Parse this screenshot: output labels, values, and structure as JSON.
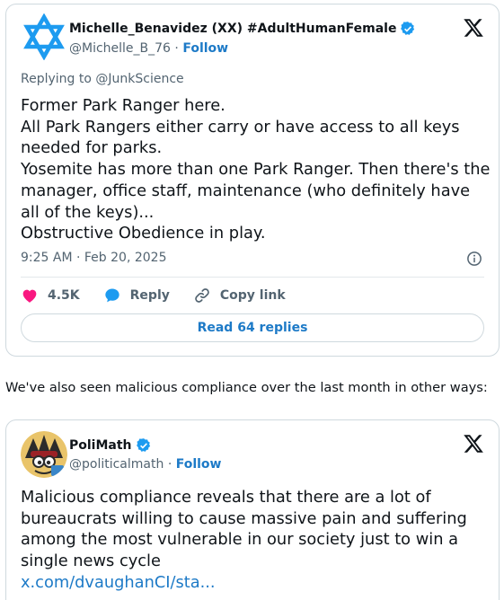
{
  "tweet1": {
    "author_name": "Michelle_Benavidez (XX) #AdultHumanFemale",
    "handle": "@Michelle_B_76",
    "separator": "·",
    "follow_label": "Follow",
    "avatar_icon": "star-of-david-icon",
    "reply_to": "Replying to @JunkScience",
    "text_lines": [
      "Former Park Ranger here.",
      "All Park Rangers either carry or have access to all keys",
      "needed for parks.",
      "Yosemite has more than one Park Ranger. Then there's the",
      "manager, office staff,  maintenance (who definitely have",
      "all of the keys)...",
      "Obstructive Obedience in play."
    ],
    "timestamp": "9:25 AM · Feb 20, 2025",
    "likes": "4.5K",
    "reply_label": "Reply",
    "copy_link_label": "Copy link",
    "read_replies_label": "Read 64 replies"
  },
  "between_text": "We've also seen malicious compliance over the last month in other ways:",
  "tweet2": {
    "author_name": "PoliMath",
    "handle": "@politicalmath",
    "separator": "·",
    "follow_label": "Follow",
    "text_lines": [
      "Malicious compliance reveals that there are a lot of",
      "bureaucrats willing to cause massive pain and suffering",
      "among the most vulnerable in our society just to win a",
      "single news cycle"
    ],
    "link_text": "x.com/dvaughanCI/sta..."
  },
  "colors": {
    "accent": "#1d9bf0",
    "link": "#1d7ac7",
    "heart": "#f91880",
    "star": "#1d9bf0",
    "muted": "#536471",
    "border": "#cfd9de"
  }
}
